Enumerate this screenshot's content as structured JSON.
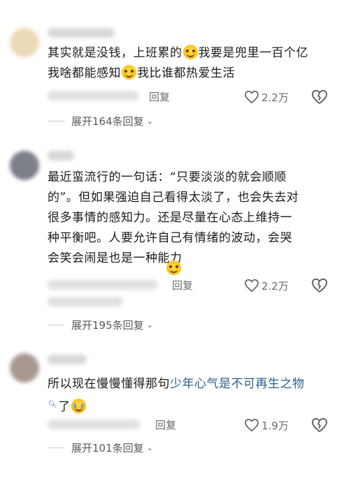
{
  "comments": [
    {
      "text_parts": [
        "其实就是没钱，上班累的",
        "我要是兜里一百个亿",
        "我啥都能感知",
        "我比谁都热爱生活"
      ],
      "reply_label": "回复",
      "likes": "2.2万",
      "expand_label": "展开164条回复",
      "avatar_color": "#ecd9b5"
    },
    {
      "text": "最近蛮流行的一句话：“只要淡淡的就会顺顺的”。但如果强迫自己看得太淡了，也会失去对很多事情的感知力。还是尽量在心态上维持一种平衡吧。人要允许自己有情绪的波动，会哭会笑会闹是也是一种能力",
      "reply_label": "回复",
      "likes": "2.2万",
      "expand_label": "展开195条回复",
      "avatar_color": "#7a7f88"
    },
    {
      "text_before": "所以现在慢慢懂得那句",
      "link_text": "少年心气是不可再生之物",
      "text_after": "了",
      "reply_label": "回复",
      "likes": "1.9万",
      "expand_label": "展开101条回复",
      "avatar_color": "#a89890"
    }
  ],
  "icons": {
    "like": "heart-outline-icon",
    "dislike": "broken-heart-icon",
    "expand": "chevron-down-icon",
    "emoji_smile": "grin-emoji-icon",
    "emoji_cry": "crying-emoji-icon",
    "search": "search-icon"
  }
}
